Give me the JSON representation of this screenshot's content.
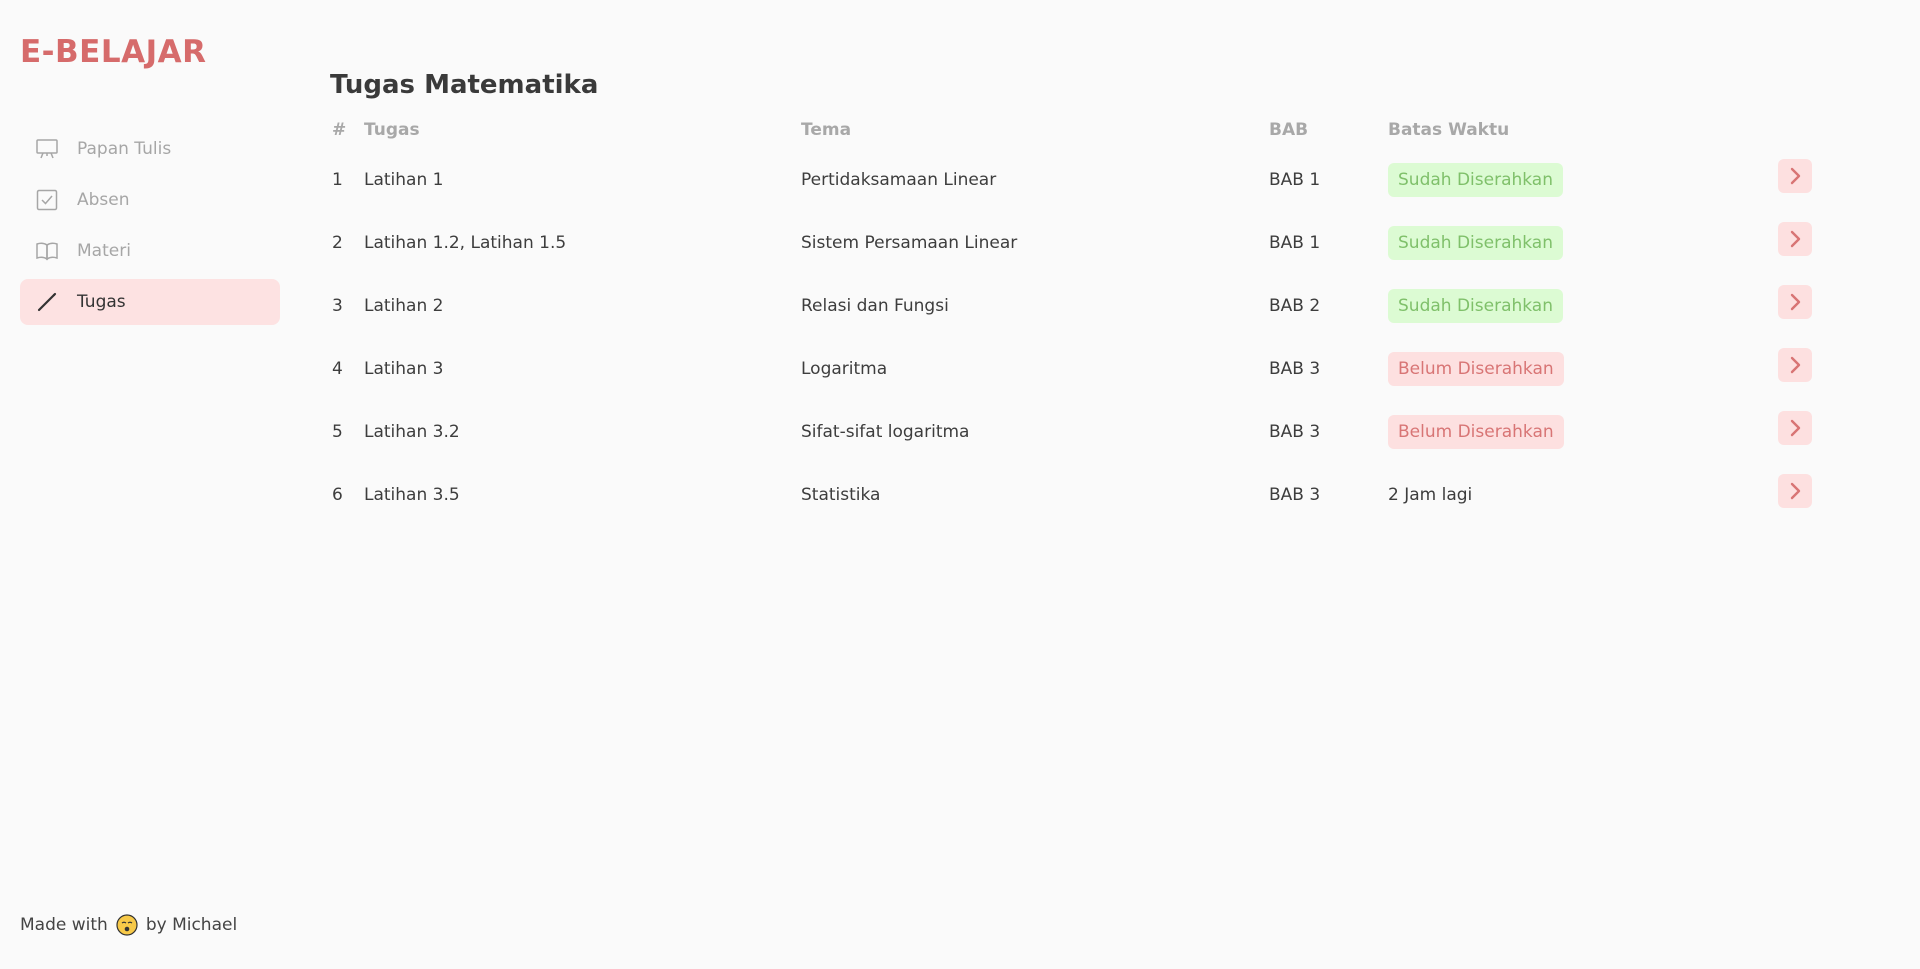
{
  "app": {
    "logo": "E-BELAJAR"
  },
  "sidebar": {
    "items": [
      {
        "label": "Papan Tulis",
        "icon": "whiteboard-icon",
        "active": false
      },
      {
        "label": "Absen",
        "icon": "checkbox-icon",
        "active": false
      },
      {
        "label": "Materi",
        "icon": "book-icon",
        "active": false
      },
      {
        "label": "Tugas",
        "icon": "pencil-icon",
        "active": true
      }
    ]
  },
  "footer": {
    "prefix": "Made with",
    "suffix": "by Michael",
    "emoji_icon": "sleepy-face-icon"
  },
  "main": {
    "title": "Tugas Matematika",
    "columns": [
      "#",
      "Tugas",
      "Tema",
      "BAB",
      "Batas Waktu"
    ],
    "rows": [
      {
        "num": "1",
        "tugas": "Latihan 1",
        "tema": "Pertidaksamaan Linear",
        "bab": "BAB 1",
        "status": "Sudah Diserahkan",
        "status_type": "green"
      },
      {
        "num": "2",
        "tugas": "Latihan 1.2, Latihan 1.5",
        "tema": "Sistem Persamaan Linear",
        "bab": "BAB 1",
        "status": "Sudah Diserahkan",
        "status_type": "green"
      },
      {
        "num": "3",
        "tugas": "Latihan 2",
        "tema": "Relasi dan Fungsi",
        "bab": "BAB 2",
        "status": "Sudah Diserahkan",
        "status_type": "green"
      },
      {
        "num": "4",
        "tugas": "Latihan 3",
        "tema": "Logaritma",
        "bab": "BAB 3",
        "status": "Belum Diserahkan",
        "status_type": "red"
      },
      {
        "num": "5",
        "tugas": "Latihan 3.2",
        "tema": "Sifat-sifat logaritma",
        "bab": "BAB 3",
        "status": "Belum Diserahkan",
        "status_type": "red"
      },
      {
        "num": "6",
        "tugas": "Latihan 3.5",
        "tema": "Statistika",
        "bab": "BAB 3",
        "status": "2 Jam lagi",
        "status_type": "plain"
      }
    ]
  },
  "colors": {
    "brand": "#d66b6b",
    "active_bg": "#fde2e2",
    "success_bg": "#dcfbd3",
    "success_fg": "#7fc06a",
    "danger_bg": "#fde0e0",
    "danger_fg": "#d87575"
  }
}
